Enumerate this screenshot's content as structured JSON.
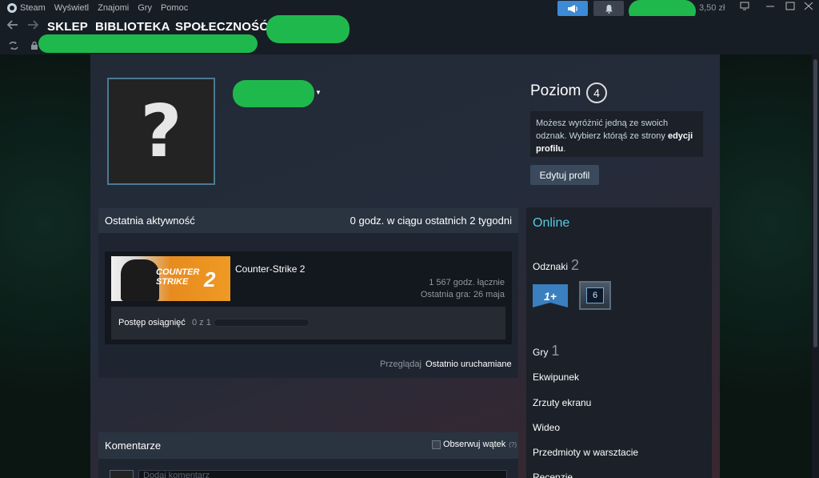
{
  "menubar": {
    "items": [
      "Steam",
      "Wyświetl",
      "Znajomi",
      "Gry",
      "Pomoc"
    ],
    "wallet": "3,50 zł",
    "announce_icon": "megaphone-icon",
    "notif_icon": "bell-icon"
  },
  "nav": {
    "back_icon": "arrow-left-icon",
    "forward_icon": "arrow-right-icon",
    "tabs": [
      "SKLEP",
      "BIBLIOTEKA",
      "SPOŁECZNOŚĆ"
    ],
    "refresh_icon": "refresh-icon",
    "lock_icon": "lock-icon"
  },
  "profile": {
    "avatar_glyph": "?",
    "level_label": "Poziom",
    "level": "4",
    "badge_hint_pre": "Możesz wyróżnić jedną ze swoich odznak. Wybierz którąś ze strony ",
    "badge_hint_link": "edycji profilu",
    "badge_hint_post": ".",
    "edit_button": "Edytuj profil"
  },
  "activity": {
    "title": "Ostatnia aktywność",
    "summary": "0 godz. w ciągu ostatnich 2 tygodni",
    "game": {
      "name": "Counter-Strike 2",
      "capsule_line1": "COUNTER",
      "capsule_line2": "STRIKE",
      "capsule_num": "2",
      "total_hours": "1 567 godz. łącznie",
      "last_played": "Ostatnia gra: 26 maja",
      "achievements_label": "Postęp osiągnięć",
      "achievements_count": "0 z 1",
      "achievements_progress": 0
    },
    "browse_label": "Przeglądaj",
    "browse_link": "Ostatnio uruchamiane"
  },
  "comments": {
    "title": "Komentarze",
    "follow_label": "Obserwuj wątek",
    "follow_help": "(?)",
    "input_placeholder": "Dodaj komentarz"
  },
  "sidebar": {
    "status": "Online",
    "badges_label": "Odznaki",
    "badges_count": "2",
    "badge1_text": "1+",
    "badge2_text": "6",
    "games_label": "Gry",
    "games_count": "1",
    "links": [
      "Ekwipunek",
      "Zrzuty ekranu",
      "Wideo",
      "Przedmioty w warsztacie",
      "Recenzje"
    ]
  },
  "colors": {
    "accent_blue": "#3d8ad6",
    "online": "#57cbde",
    "redaction": "#1fb84d"
  }
}
